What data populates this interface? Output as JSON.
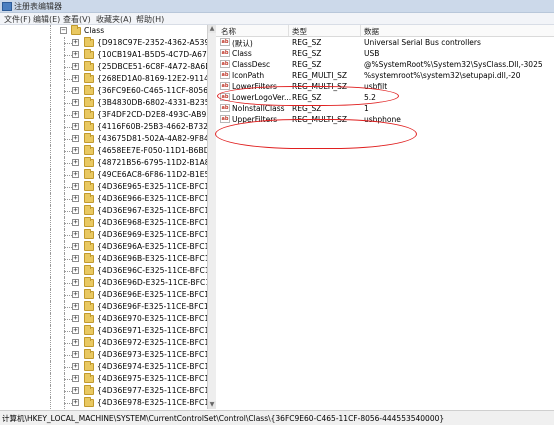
{
  "window": {
    "title": "注册表编辑器"
  },
  "menu": [
    "文件(F)",
    "编辑(E)",
    "查看(V)",
    "收藏夹(A)",
    "帮助(H)"
  ],
  "tree": {
    "root_label": "Class",
    "items": [
      "{D918C97E-2352-4362-A539-10A",
      "{10CB19A1-B5D5-4C7D-A670-95",
      "{25DBCE51-6C8F-4A72-8A6D-B5",
      "{268ED1A0-8169-12E2-9114-082",
      "{36FC9E60-C465-11CF-8056-444",
      "{3B4830DB-6802-4331-B235-67I",
      "{3F4DF2CD-D2E8-493C-AB93-08",
      "{4116F60B-25B3-4662-B732-99A",
      "{43675D81-502A-4A82-9F84-B75",
      "{4658EE7E-F050-11D1-B6BD-00(",
      "{48721B56-6795-11D2-B1A8-008",
      "{49CE6AC8-6F86-11D2-B1E5-008",
      "{4D36E965-E325-11CE-BFC1-080",
      "{4D36E966-E325-11CE-BFC1-080",
      "{4D36E967-E325-11CE-BFC1-080",
      "{4D36E968-E325-11CE-BFC1-080",
      "{4D36E969-E325-11CE-BFC1-080",
      "{4D36E96A-E325-11CE-BFC1-080",
      "{4D36E96B-E325-11CE-BFC1-080",
      "{4D36E96C-E325-11CE-BFC1-080",
      "{4D36E96D-E325-11CE-BFC1-080",
      "{4D36E96E-E325-11CE-BFC1-080",
      "{4D36E96F-E325-11CE-BFC1-080",
      "{4D36E970-E325-11CE-BFC1-080",
      "{4D36E971-E325-11CE-BFC1-080",
      "{4D36E972-E325-11CE-BFC1-080",
      "{4D36E973-E325-11CE-BFC1-080",
      "{4D36E974-E325-11CE-BFC1-080",
      "{4D36E975-E325-11CE-BFC1-080",
      "{4D36E977-E325-11CE-BFC1-080",
      "{4D36E978-E325-11CE-BFC1-080"
    ]
  },
  "list": {
    "headers": {
      "name": "名称",
      "type": "类型",
      "data": "数据"
    },
    "rows": [
      {
        "icon": "ab",
        "name": "(默认)",
        "type": "REG_SZ",
        "data": "Universal Serial Bus controllers"
      },
      {
        "icon": "ab",
        "name": "Class",
        "type": "REG_SZ",
        "data": "USB"
      },
      {
        "icon": "ab",
        "name": "ClassDesc",
        "type": "REG_SZ",
        "data": "@%SystemRoot%\\System32\\SysClass.Dll,-3025"
      },
      {
        "icon": "ab",
        "name": "IconPath",
        "type": "REG_MULTI_SZ",
        "data": "%systemroot%\\system32\\setupapi.dll,-20"
      },
      {
        "icon": "ab",
        "name": "LowerFilters",
        "type": "REG_MULTI_SZ",
        "data": "usbfilt"
      },
      {
        "icon": "ab",
        "name": "LowerLogoVer...",
        "type": "REG_SZ",
        "data": "5.2"
      },
      {
        "icon": "ab",
        "name": "NoInstallClass",
        "type": "REG_SZ",
        "data": "1"
      },
      {
        "icon": "ab",
        "name": "UpperFilters",
        "type": "REG_MULTI_SZ",
        "data": "usbphone"
      }
    ]
  },
  "status": {
    "path": "计算机\\HKEY_LOCAL_MACHINE\\SYSTEM\\CurrentControlSet\\Control\\Class\\{36FC9E60-C465-11CF-8056-444553540000}"
  },
  "colors": {
    "annotation": "#e02020",
    "folder": "#e9c861",
    "selection": "#3399ff"
  }
}
